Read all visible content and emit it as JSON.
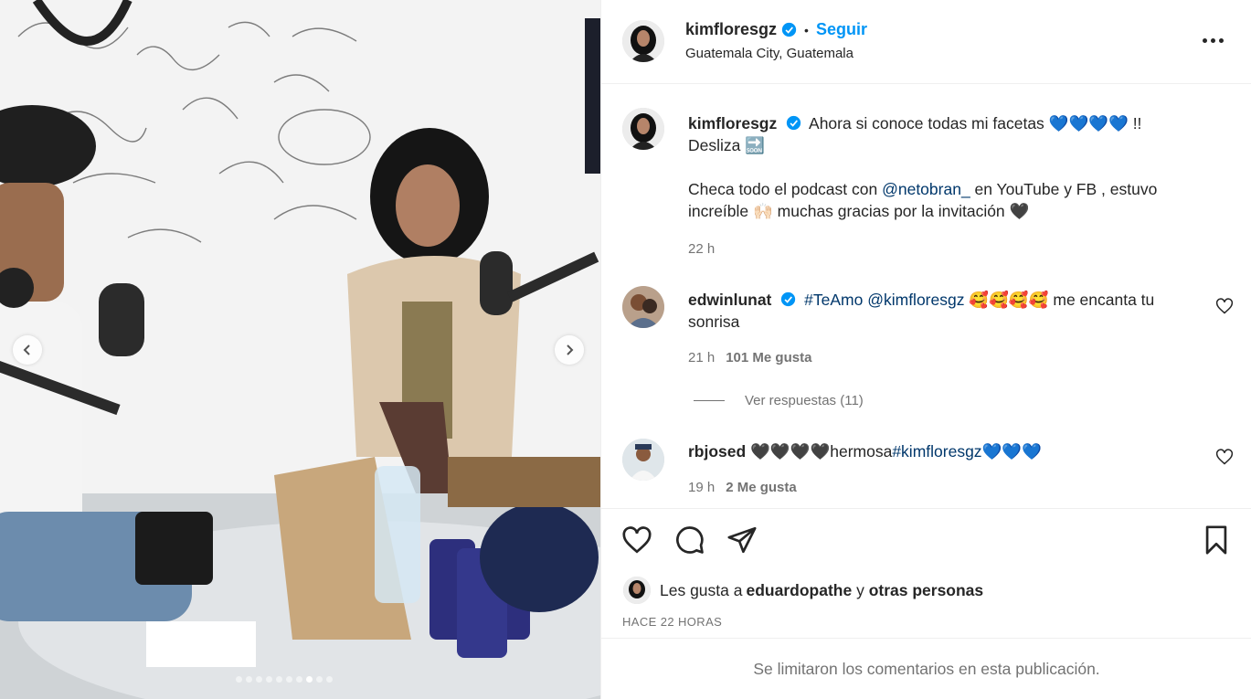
{
  "post": {
    "author": "kimfloresgz",
    "follow_label": "Seguir",
    "location": "Guatemala City, Guatemala",
    "separator": "•"
  },
  "caption": {
    "username": "kimfloresgz",
    "line1": "Ahora si conoce todas mi facetas 💙💙💙💙 !! Desliza 🔜",
    "line2_prefix": "Checa todo el podcast con ",
    "mention": "@netobran_",
    "line2_suffix": " en YouTube y FB , estuvo increíble 🙌🏻 muchas gracias por la invitación 🖤",
    "time": "22 h"
  },
  "comments": [
    {
      "username": "edwinlunat",
      "hashtag": "#TeAmo",
      "mention": "@kimfloresgz",
      "text": " 🥰🥰🥰🥰 me encanta tu sonrisa",
      "time": "21 h",
      "likes": "101 Me gusta",
      "replies_label": "Ver respuestas (11)"
    },
    {
      "username": "rbjosed",
      "text_prefix": " 🖤🖤🖤🖤hermosa",
      "hashtag": "#kimfloresgz",
      "text_suffix": "💙💙💙",
      "time": "19 h",
      "likes": "2 Me gusta"
    }
  ],
  "likes_summary": {
    "prefix": "Les gusta a ",
    "user": "eduardopathe",
    "middle": " y ",
    "others": "otras personas"
  },
  "posted_ago": "HACE 22 HORAS",
  "comments_limited": "Se limitaron los comentarios en esta publicación.",
  "carousel": {
    "total": 10,
    "active": 8
  },
  "colors": {
    "link": "#00376b",
    "follow": "#0095f6",
    "verified": "#0095f6",
    "muted": "#737373"
  }
}
